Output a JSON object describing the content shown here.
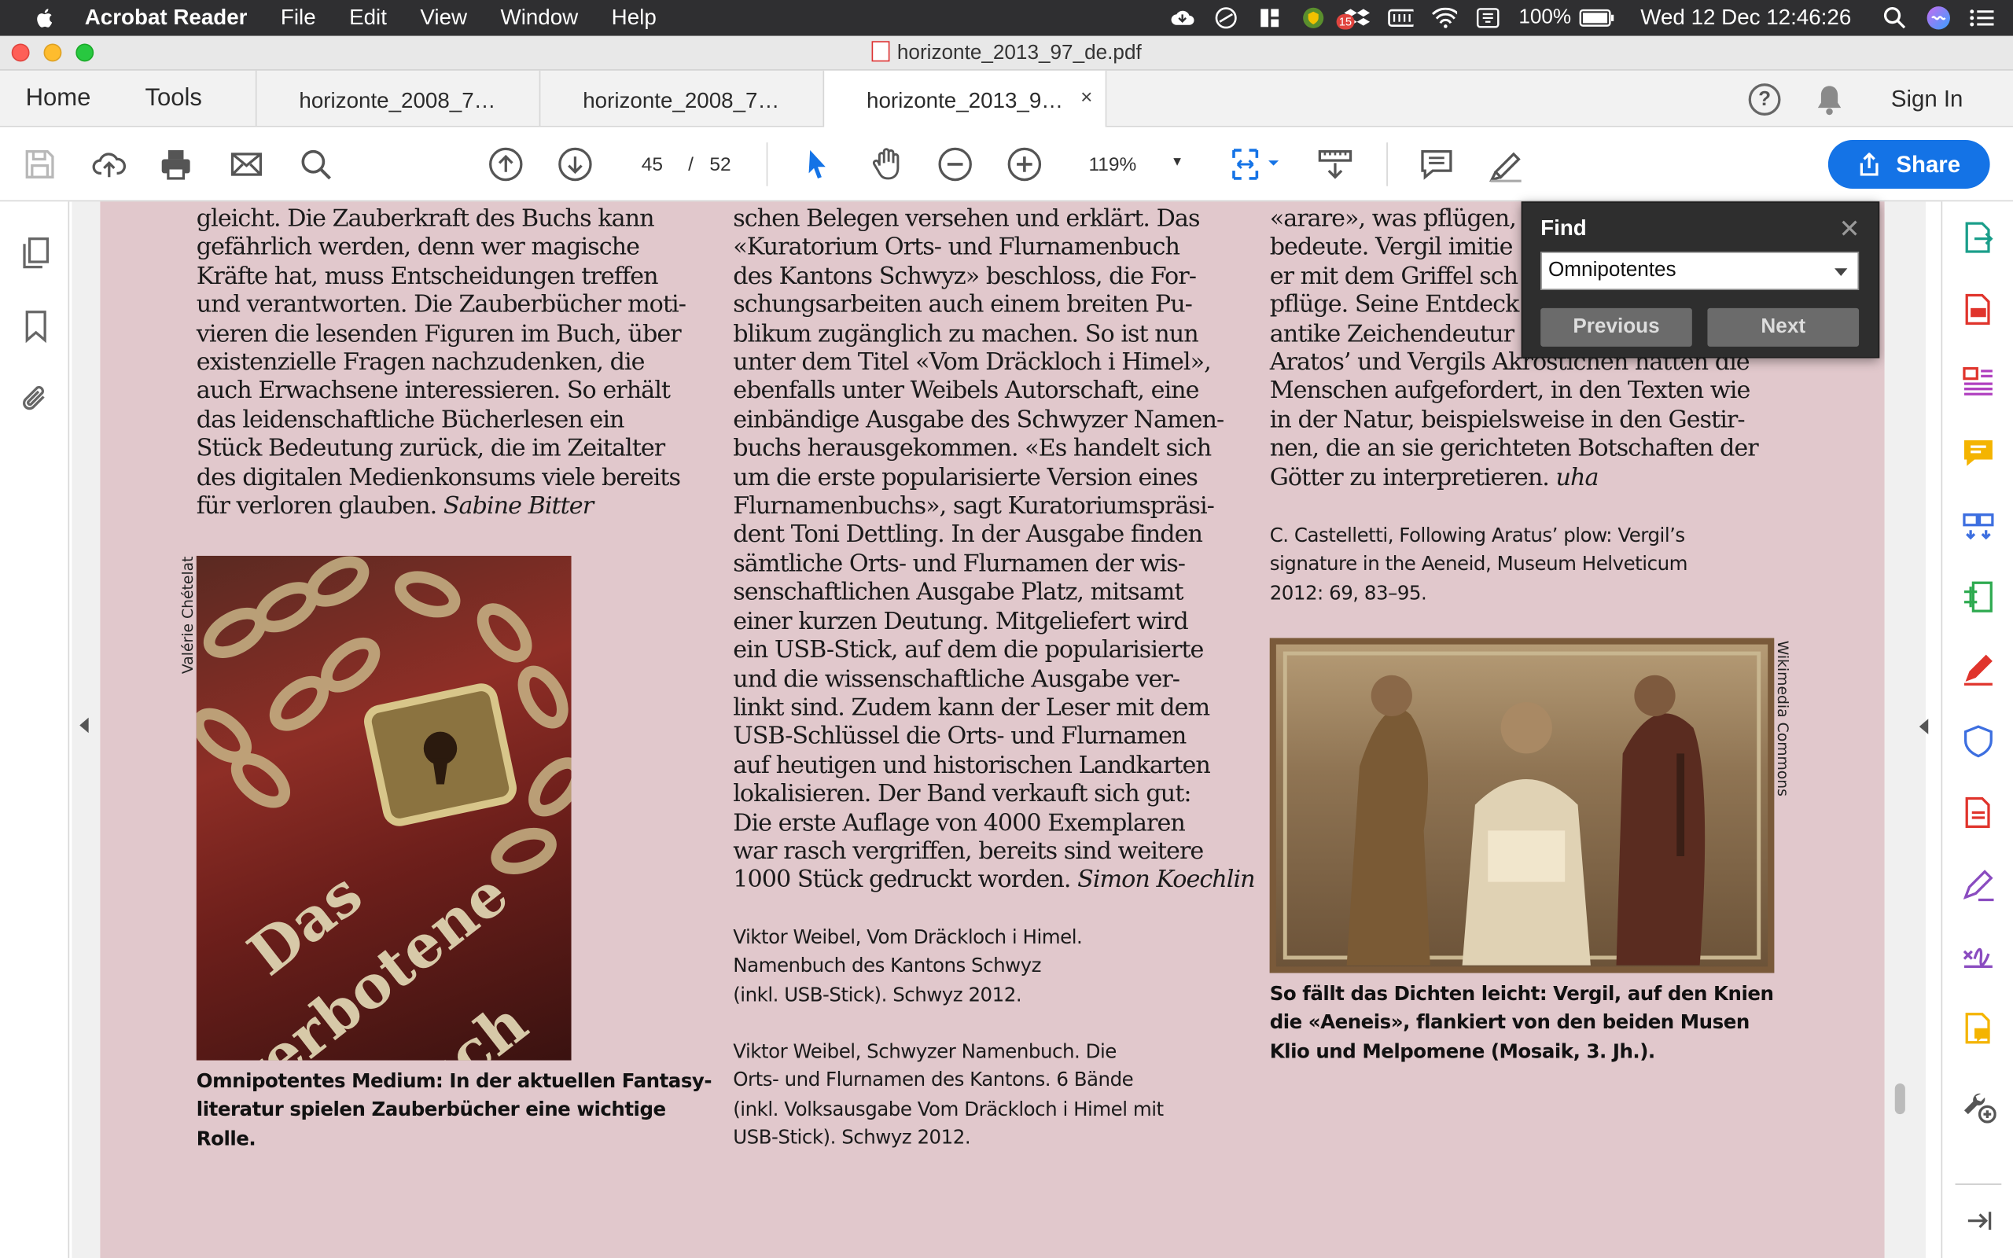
{
  "menubar": {
    "app_name": "Acrobat Reader",
    "menus": [
      "File",
      "Edit",
      "View",
      "Window",
      "Help"
    ],
    "notification_badge": "15",
    "battery": "100%",
    "clock": "Wed 12 Dec  12:46:26"
  },
  "window": {
    "title": "horizonte_2013_97_de.pdf"
  },
  "tabbar": {
    "home": "Home",
    "tools": "Tools",
    "tabs": [
      {
        "label": "horizonte_2008_7…"
      },
      {
        "label": "horizonte_2008_7…"
      },
      {
        "label": "horizonte_2013_9…",
        "close": "×"
      }
    ],
    "help": "?",
    "sign_in": "Sign In"
  },
  "toolbar": {
    "current_page": "45",
    "page_separator": "/",
    "total_pages": "52",
    "zoom": "119%",
    "share_label": "Share"
  },
  "find": {
    "title": "Find",
    "close": "✕",
    "query": "Omnipotentes",
    "previous": "Previous",
    "next": "Next"
  },
  "document": {
    "col1_lines": [
      "gleicht. Die Zauberkraft des Buchs kann",
      "gefährlich werden, denn wer magische",
      "Kräfte hat, muss Entscheidungen treffen",
      "und verantworten. Die Zauberbücher moti-",
      "vieren die lesenden Figuren im Buch, über",
      "existenzielle Fragen nachzudenken, die",
      "auch Erwachsene interessieren. So erhält",
      "das leidenschaftliche Bücherlesen ein",
      "Stück Bedeutung zurück, die im Zeitalter",
      "des digitalen Medienkonsums viele bereits"
    ],
    "col1_last": "für verloren glauben.",
    "col1_author": "Sabine Bitter",
    "book_credit": "Valérie Chételat",
    "book_cover_text": [
      "Das",
      "verbotene",
      "Buch"
    ],
    "book_caption": [
      "Omnipotentes Medium: In der aktuellen Fantasy-",
      "literatur spielen Zauberbücher eine wichtige",
      "Rolle."
    ],
    "col2_lines": [
      "schen Belegen versehen und erklärt. Das",
      "«Kuratorium Orts- und Flurnamenbuch",
      "des Kantons Schwyz» beschloss, die For-",
      "schungsarbeiten auch einem breiten Pu-",
      "blikum zugänglich zu machen. So ist nun",
      "unter dem Titel «Vom Dräckloch i Himel»,",
      "ebenfalls unter Weibels Autorschaft, eine",
      "einbändige Ausgabe des Schwyzer Namen-",
      "buchs herausgekommen. «Es handelt sich",
      "um die erste popularisierte Version eines",
      "Flurnamenbuchs», sagt Kuratoriumspräsi-",
      "dent Toni Dettling. In der Ausgabe finden",
      "sämtliche Orts- und Flurnamen der wis-",
      "senschaftlichen Ausgabe Platz, mitsamt",
      "einer kurzen Deutung. Mitgeliefert wird",
      "ein USB-Stick, auf dem die popularisierte",
      "und die wissenschaftliche Ausgabe ver-",
      "linkt sind. Zudem kann der Leser mit dem",
      "USB-Schlüssel die Orts- und Flurnamen",
      "auf heutigen und historischen Landkarten",
      "lokalisieren. Der Band verkauft sich gut:",
      "Die erste Auflage von 4000 Exemplaren",
      "war rasch vergriffen, bereits sind weitere"
    ],
    "col2_last": "1000 Stück gedruckt worden.",
    "col2_author": "Simon Koechlin",
    "col2_ref1": [
      "Viktor Weibel, Vom Dräckloch i Himel.",
      "Namenbuch des Kantons Schwyz",
      "(inkl. USB-Stick). Schwyz 2012."
    ],
    "col2_ref2": [
      "Viktor Weibel, Schwyzer Namenbuch. Die",
      "Orts- und Flurnamen des Kantons. 6 Bände",
      "(inkl. Volksausgabe Vom Dräckloch i Himel mit",
      "USB-Stick). Schwyz 2012."
    ],
    "col3_lines": [
      "«arare», was pflügen, a",
      "bedeute. Vergil imitie",
      "er mit dem Griffel sch",
      "pflüge. Seine Entdeck",
      "antike Zeichendeutur",
      "Aratos’ und Vergils Akrostichen hatten die",
      "Menschen aufgefordert, in den Texten wie",
      "in der Natur, beispielsweise in den Gestir-",
      "nen, die an sie gerichteten Botschaften der"
    ],
    "col3_last": "Götter zu interpretieren.",
    "col3_author": "uha",
    "col3_ref": [
      "C. Castelletti, Following Aratus’ plow: Vergil’s",
      "signature in the Aeneid, Museum Helveticum",
      "2012: 69, 83–95."
    ],
    "mosaic_credit": "Wikimedia Commons",
    "mosaic_caption": [
      "So fällt das Dichten leicht: Vergil, auf den Knien",
      "die «Aeneis», flankiert von den beiden Musen",
      "Klio und Melpomene (Mosaik, 3. Jh.)."
    ]
  }
}
